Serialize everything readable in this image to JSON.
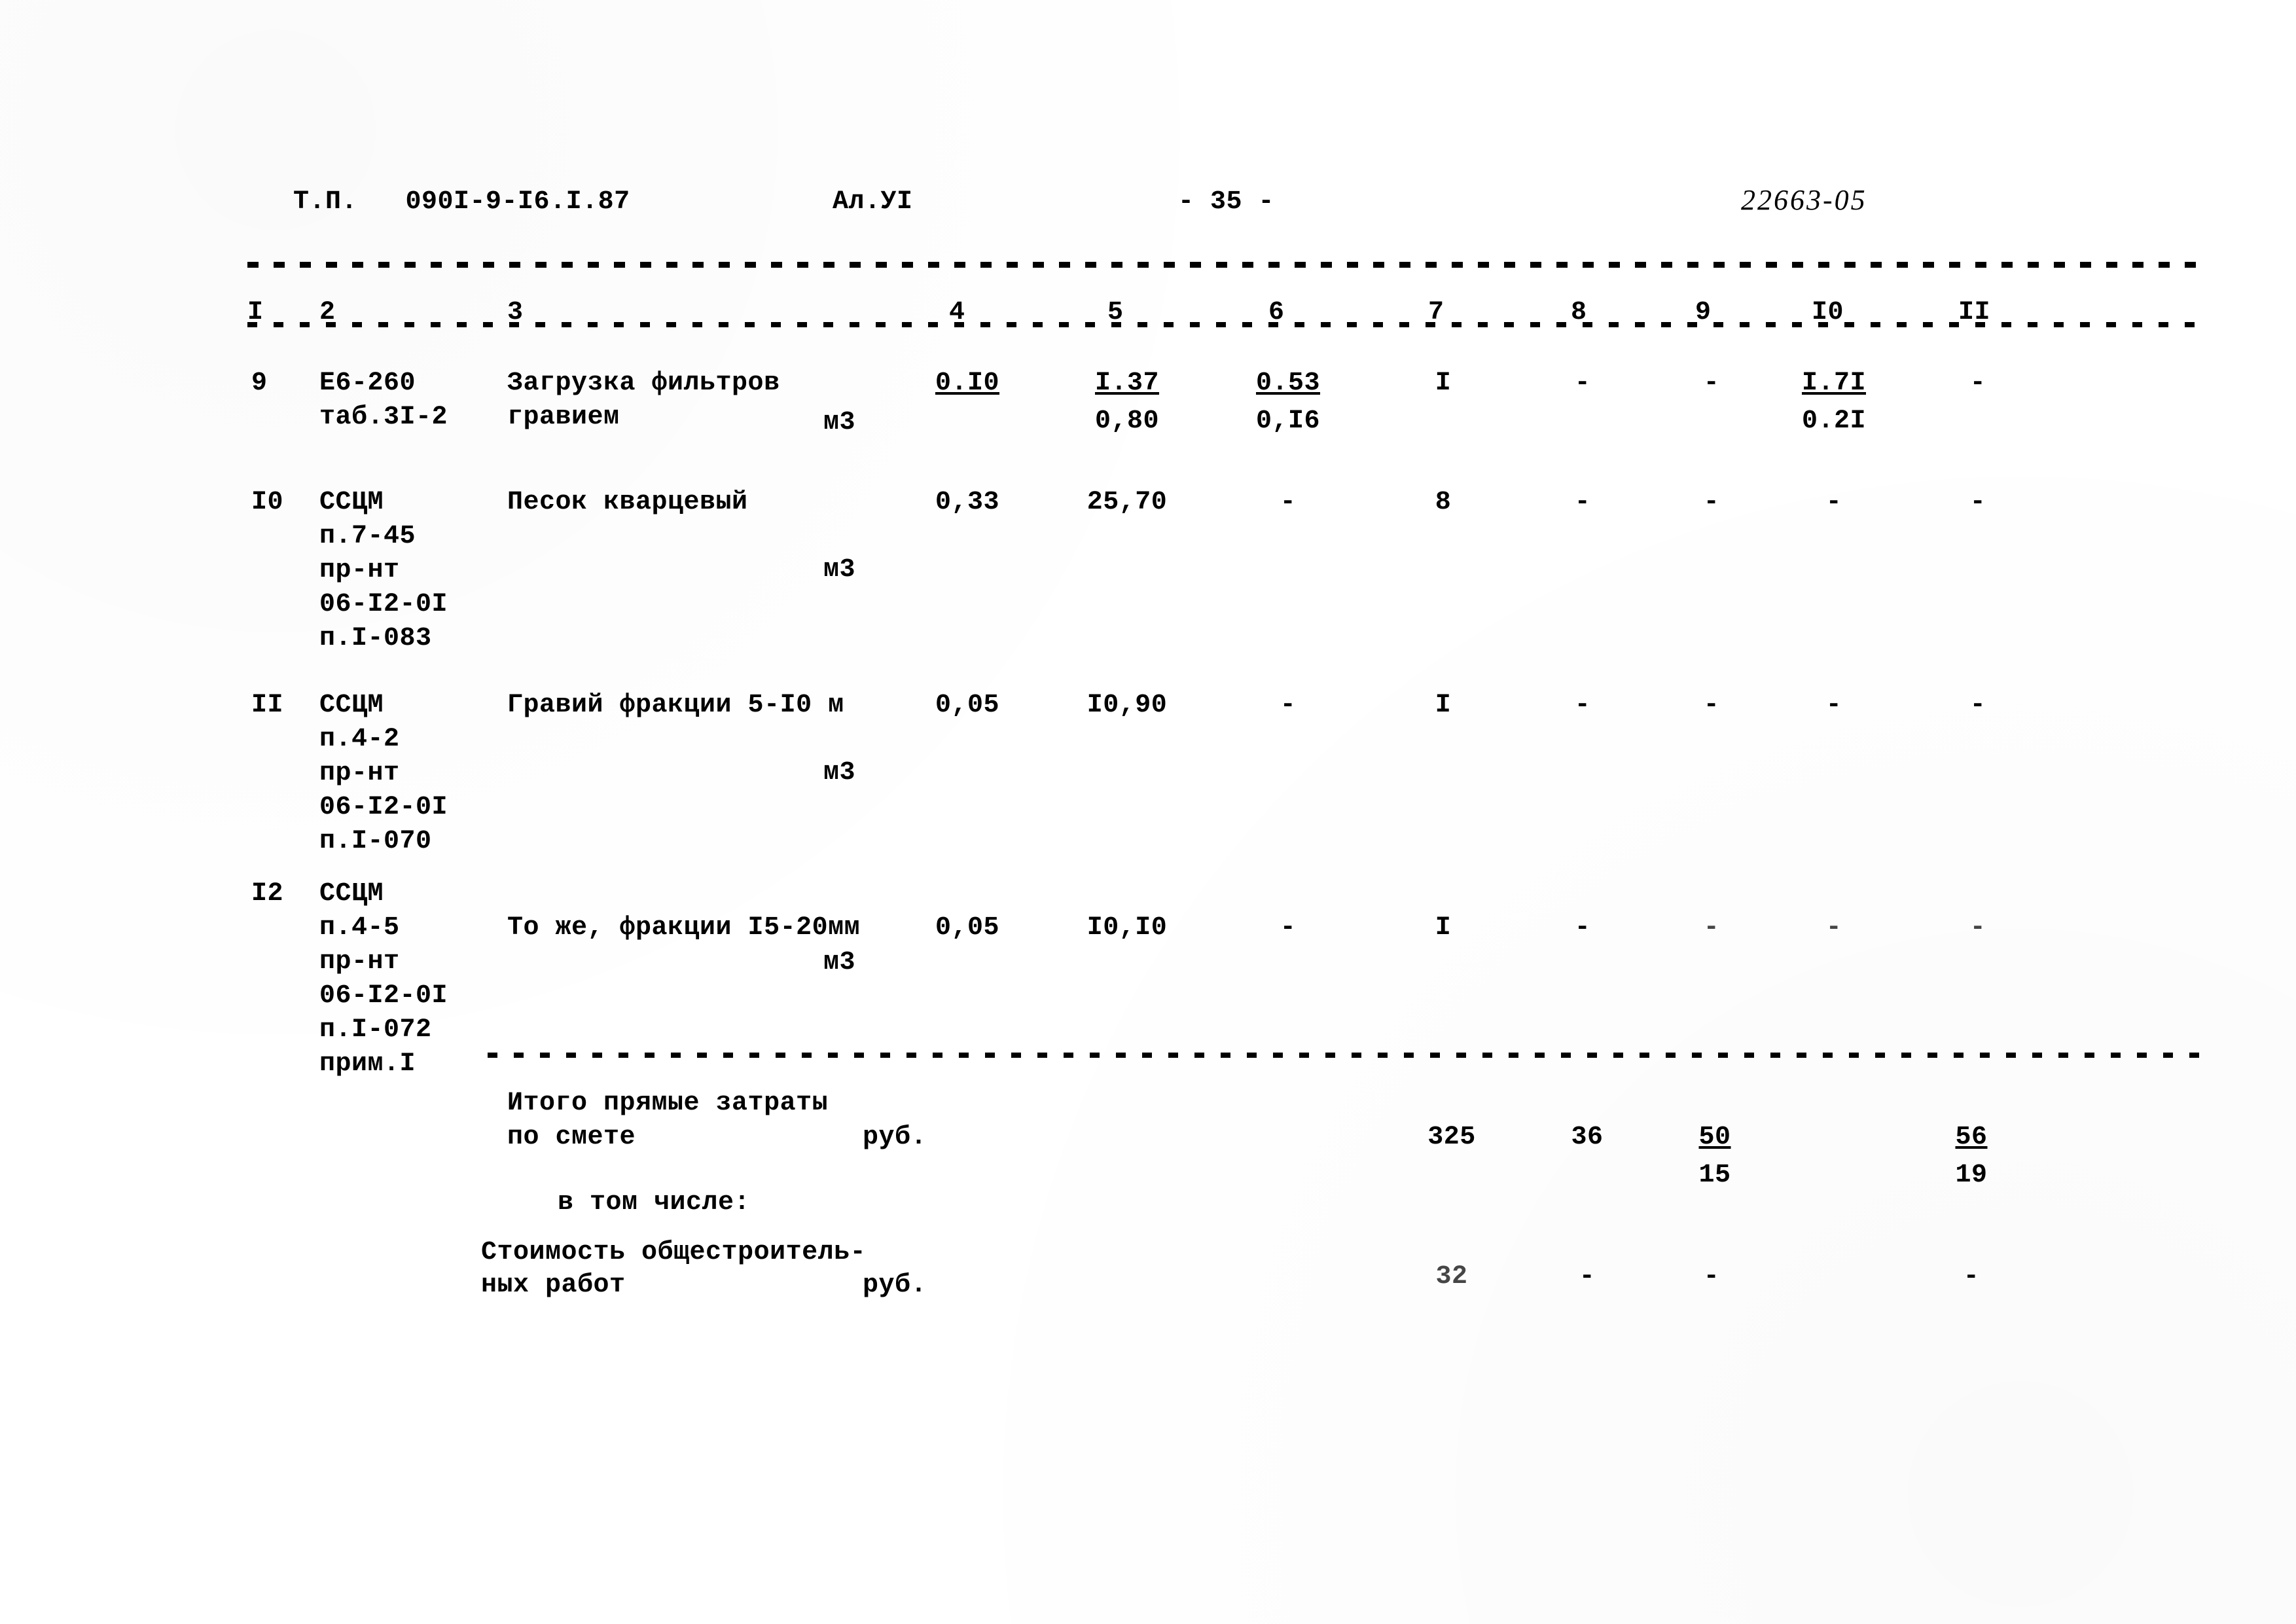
{
  "header": {
    "doc_code": "Т.П.   090I-9-I6.I.87",
    "album": "Ал.УI",
    "page_number": "- 35 -",
    "archive_stamp": "22663-05"
  },
  "table": {
    "column_headers": [
      "I",
      "2",
      "3",
      "4",
      "5",
      "6",
      "7",
      "8",
      "9",
      "I0",
      "II"
    ],
    "rows": [
      {
        "no": "9",
        "code": "Е6-260\nтаб.3I-2",
        "name": "Загрузка фильтров\nгравием",
        "unit": "м3",
        "c4": "0.I0",
        "c4_underline": true,
        "c5_top": "I.37",
        "c5_bottom": "0,80",
        "c6_top": "0.53",
        "c6_bottom": "0,I6",
        "c7": "I",
        "c8": "-",
        "c9": "-",
        "c10_top": "I.7I",
        "c10_bottom": "0.2I",
        "c11": "-"
      },
      {
        "no": "I0",
        "code": "ССЦМ\nп.7-45\nпр-нт\n06-I2-0I\nп.I-083",
        "name": "Песок кварцевый",
        "unit": "м3",
        "c4": "0,33",
        "c4_underline": false,
        "c5_top": "25,70",
        "c5_bottom": "",
        "c6_top": "-",
        "c6_bottom": "",
        "c7": "8",
        "c8": "-",
        "c9": "-",
        "c10_top": "-",
        "c10_bottom": "",
        "c11": "-"
      },
      {
        "no": "II",
        "code": "ССЦМ\nп.4-2\nпр-нт\n06-I2-0I\nп.I-070",
        "name": "Гравий фракции 5-I0 м",
        "unit": "м3",
        "c4": "0,05",
        "c4_underline": false,
        "c5_top": "I0,90",
        "c5_bottom": "",
        "c6_top": "-",
        "c6_bottom": "",
        "c7": "I",
        "c8": "-",
        "c9": "-",
        "c10_top": "-",
        "c10_bottom": "",
        "c11": "-"
      },
      {
        "no": "I2",
        "code": "ССЦМ\nп.4-5\nпр-нт\n06-I2-0I\nп.I-072\nприм.I",
        "name": "То же, фракции I5-20мм",
        "unit": "м3",
        "c4": "0,05",
        "c4_underline": false,
        "c5_top": "I0,I0",
        "c5_bottom": "",
        "c6_top": "-",
        "c6_bottom": "",
        "c7": "I",
        "c8": "-",
        "c9": "-",
        "c10_top": "-",
        "c10_bottom": "",
        "c11": "-"
      }
    ]
  },
  "summary": {
    "total_label_line1": "Итого прямые затраты",
    "total_label_line2": "по смете",
    "total_unit": "руб.",
    "total_c7": "325",
    "total_c8": "36",
    "total_c9_top": "50",
    "total_c9_bottom": "15",
    "total_c10_top": "56",
    "total_c10_bottom": "19",
    "including_label": "в том числе:",
    "sub_label_line1": "Стоимость общестроитель-",
    "sub_label_line2": "ных работ",
    "sub_unit": "руб.",
    "sub_c7": "32",
    "sub_c8": "-",
    "sub_c9": "-",
    "sub_c10": "-"
  }
}
